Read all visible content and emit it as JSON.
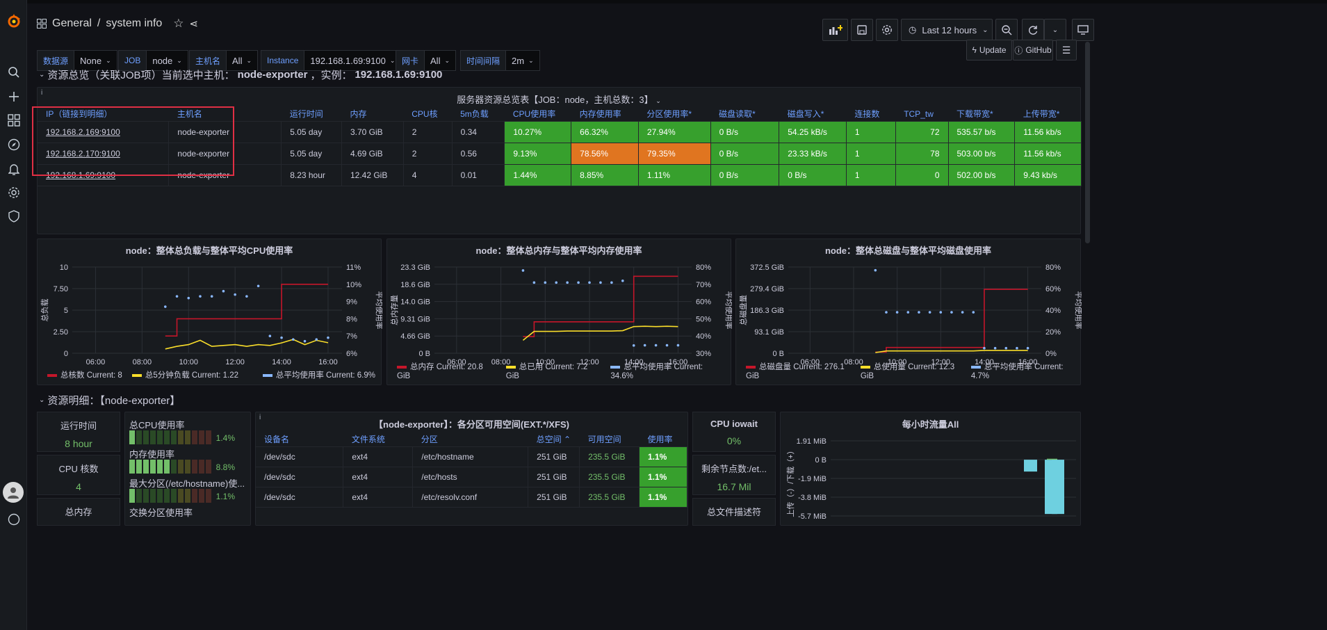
{
  "breadcrumb": {
    "folder": "General",
    "separator": "/",
    "title": "system info"
  },
  "time": {
    "range": "Last 12 hours"
  },
  "variables": [
    {
      "label": "数据源",
      "value": "None"
    },
    {
      "label": "JOB",
      "value": "node"
    },
    {
      "label": "主机名",
      "value": "All"
    },
    {
      "label": "Instance",
      "value": "192.168.1.69:9100"
    },
    {
      "label": "网卡",
      "value": "All"
    },
    {
      "label": "时间间隔",
      "value": "2m"
    }
  ],
  "links": {
    "update": "Update",
    "github": "GitHub"
  },
  "row1": {
    "title": "资源总览（关联JOB项）当前选中主机：",
    "host": "node-exporter",
    "sep": "，实例：",
    "instance": "192.168.1.69:9100"
  },
  "overview": {
    "title": "服务器资源总览表【JOB：node，主机总数：3】",
    "headers": [
      "IP（链接到明细）",
      "主机名",
      "运行时间",
      "内存",
      "CPU核",
      "5m负载",
      "CPU使用率",
      "内存使用率",
      "分区使用率*",
      "磁盘读取*",
      "磁盘写入*",
      "连接数",
      "TCP_tw",
      "下载带宽*",
      "上传带宽*"
    ],
    "rows": [
      [
        "192.168.2.169:9100",
        "node-exporter",
        "5.05 day",
        "3.70 GiB",
        "2",
        "0.34",
        "10.27%",
        "66.32%",
        "27.94%",
        "0 B/s",
        "54.25 kB/s",
        "1",
        "72",
        "535.57 b/s",
        "11.56 kb/s"
      ],
      [
        "192.168.2.170:9100",
        "node-exporter",
        "5.05 day",
        "4.69 GiB",
        "2",
        "0.56",
        "9.13%",
        "78.56%",
        "79.35%",
        "0 B/s",
        "23.33 kB/s",
        "1",
        "78",
        "503.00 b/s",
        "11.56 kb/s"
      ],
      [
        "192.168.1.69:9100",
        "node-exporter",
        "8.23 hour",
        "12.42 GiB",
        "4",
        "0.01",
        "1.44%",
        "8.85%",
        "1.11%",
        "0 B/s",
        "0 B/s",
        "1",
        "0",
        "502.00 b/s",
        "9.43 kb/s"
      ]
    ],
    "cell_colors": [
      [
        "",
        "",
        "",
        "",
        "",
        "",
        "green",
        "green",
        "green",
        "green",
        "green",
        "green",
        "green",
        "green",
        "green"
      ],
      [
        "",
        "",
        "",
        "",
        "",
        "",
        "green",
        "orange",
        "orange",
        "green",
        "green",
        "green",
        "green",
        "green",
        "green"
      ],
      [
        "",
        "",
        "",
        "",
        "",
        "",
        "green",
        "green",
        "green",
        "green",
        "green",
        "green",
        "green",
        "green",
        "green"
      ]
    ]
  },
  "colors": {
    "red": "#c4162a",
    "yellow": "#fade2a",
    "cyan": "#8ab8ff",
    "green": "#37a02d",
    "orange": "#e07520",
    "highlight": "#e02f44",
    "accent": "#6e9fff"
  },
  "chart_data": [
    {
      "type": "line",
      "title": "node：整体总负载与整体平均CPU使用率",
      "x": [
        "09:00",
        "09:30",
        "10:00",
        "10:30",
        "11:00",
        "11:30",
        "12:00",
        "12:30",
        "13:00",
        "13:30",
        "14:00",
        "14:30",
        "15:00",
        "15:30",
        "16:00"
      ],
      "xticks": [
        "06:00",
        "08:00",
        "10:00",
        "12:00",
        "14:00",
        "16:00"
      ],
      "ylabel": "总负载",
      "ylabel2": "平均使用率",
      "yticks": [
        "0",
        "2.50",
        "5",
        "7.50",
        "10"
      ],
      "yticks2": [
        "6%",
        "7%",
        "8%",
        "9%",
        "10%",
        "11%"
      ],
      "ylim": [
        0,
        10
      ],
      "ylim2": [
        6,
        11
      ],
      "series": [
        {
          "name": "总核数",
          "axis": "left",
          "color": "#c4162a",
          "values": [
            2,
            4,
            4,
            4,
            4,
            4,
            4,
            4,
            4,
            4,
            8,
            8,
            8,
            8,
            8
          ]
        },
        {
          "name": "总5分钟负载",
          "axis": "left",
          "color": "#fade2a",
          "values": [
            0.5,
            0.8,
            1.0,
            1.5,
            0.8,
            0.9,
            1.0,
            0.8,
            1.0,
            0.9,
            1.2,
            1.6,
            1.0,
            1.5,
            1.22
          ]
        },
        {
          "name": "总平均使用率",
          "axis": "right",
          "color": "#8ab8ff",
          "points": true,
          "values": [
            8.7,
            9.3,
            9.2,
            9.3,
            9.3,
            9.6,
            9.4,
            9.3,
            9.9,
            7,
            6.9,
            6.8,
            6.7,
            6.8,
            6.9
          ]
        }
      ],
      "legend": [
        {
          "name": "总核数",
          "current": "Current: 8"
        },
        {
          "name": "总5分钟负载",
          "current": "Current: 1.22"
        },
        {
          "name": "总平均使用率",
          "current": "Current: 6.9%"
        }
      ]
    },
    {
      "type": "line",
      "title": "node：整体总内存与整体平均内存使用率",
      "x": [
        "09:00",
        "09:30",
        "10:00",
        "10:30",
        "11:00",
        "11:30",
        "12:00",
        "12:30",
        "13:00",
        "13:30",
        "14:00",
        "14:30",
        "15:00",
        "15:30",
        "16:00"
      ],
      "xticks": [
        "06:00",
        "08:00",
        "10:00",
        "12:00",
        "14:00",
        "16:00"
      ],
      "ylabel": "总内存量",
      "ylabel2": "平均使用率",
      "yticks": [
        "0 B",
        "4.66 GiB",
        "9.31 GiB",
        "14.0 GiB",
        "18.6 GiB",
        "23.3 GiB"
      ],
      "yticks2": [
        "30%",
        "40%",
        "50%",
        "60%",
        "70%",
        "80%"
      ],
      "ylim": [
        0,
        23.3
      ],
      "ylim2": [
        30,
        80
      ],
      "series": [
        {
          "name": "总内存",
          "axis": "left",
          "color": "#c4162a",
          "values": [
            4.5,
            8.5,
            8.5,
            8.5,
            8.5,
            8.5,
            8.5,
            8.5,
            8.5,
            8.5,
            20.8,
            20.8,
            20.8,
            20.8,
            20.8
          ]
        },
        {
          "name": "总已用",
          "axis": "left",
          "color": "#fade2a",
          "values": [
            3.5,
            5.9,
            5.9,
            5.9,
            6.0,
            6.0,
            6.0,
            6.0,
            6.0,
            6.1,
            7.2,
            7.3,
            7.2,
            7.3,
            7.2
          ]
        },
        {
          "name": "总平均使用率",
          "axis": "right",
          "color": "#8ab8ff",
          "points": true,
          "values": [
            78,
            71,
            71,
            71,
            71,
            71,
            71,
            71,
            71,
            72,
            34.5,
            34.6,
            34.6,
            34.6,
            34.6
          ]
        }
      ],
      "legend": [
        {
          "name": "总内存",
          "current": "Current: 20.8 GiB"
        },
        {
          "name": "总已用",
          "current": "Current: 7.2 GiB"
        },
        {
          "name": "总平均使用率",
          "current": "Current: 34.6%"
        }
      ]
    },
    {
      "type": "line",
      "title": "node：整体总磁盘与整体平均磁盘使用率",
      "x": [
        "09:00",
        "09:30",
        "10:00",
        "10:30",
        "11:00",
        "11:30",
        "12:00",
        "12:30",
        "13:00",
        "13:30",
        "14:00",
        "14:30",
        "15:00",
        "15:30",
        "16:00"
      ],
      "xticks": [
        "06:00",
        "08:00",
        "10:00",
        "12:00",
        "14:00",
        "16:00"
      ],
      "ylabel": "总磁盘量",
      "ylabel2": "平均使用率",
      "yticks": [
        "0 B",
        "93.1 GiB",
        "186.3 GiB",
        "279.4 GiB",
        "372.5 GiB"
      ],
      "yticks2": [
        "0%",
        "20%",
        "40%",
        "60%",
        "80%"
      ],
      "ylim": [
        0,
        372.5
      ],
      "ylim2": [
        0,
        80
      ],
      "series": [
        {
          "name": "总磁盘量",
          "axis": "left",
          "color": "#c4162a",
          "values": [
            5,
            25,
            25,
            25,
            25,
            25,
            25,
            25,
            25,
            25,
            276.1,
            276.1,
            276.1,
            276.1,
            276.1
          ]
        },
        {
          "name": "总使用量",
          "axis": "left",
          "color": "#fade2a",
          "values": [
            3,
            10,
            10,
            10,
            10,
            10,
            10,
            10,
            10,
            10,
            12.3,
            12.3,
            12.3,
            12.3,
            12.3
          ]
        },
        {
          "name": "总平均使用率",
          "axis": "right",
          "color": "#8ab8ff",
          "points": true,
          "values": [
            77,
            38,
            38,
            38,
            38,
            38,
            38,
            38,
            38,
            38,
            4.7,
            4.7,
            4.7,
            4.7,
            4.7
          ]
        }
      ],
      "legend": [
        {
          "name": "总磁盘量",
          "current": "Current: 276.1 GiB"
        },
        {
          "name": "总使用量",
          "current": "Current: 12.3 GiB"
        },
        {
          "name": "总平均使用率",
          "current": "Current: 4.7%"
        }
      ]
    }
  ],
  "row2": {
    "title": "资源明细：【node-exporter】"
  },
  "stats": {
    "uptime": {
      "label": "运行时间",
      "value": "8 hour"
    },
    "cores": {
      "label": "CPU 核数",
      "value": "4"
    },
    "totalmem": {
      "label": "总内存"
    },
    "iowait": {
      "label": "CPU iowait",
      "value": "0%"
    },
    "nodes": {
      "label": "剩余节点数:/et...",
      "value": "16.7 Mil"
    },
    "fd": {
      "label": "总文件描述符"
    }
  },
  "bars": [
    {
      "label": "总CPU使用率",
      "value": "1.4%",
      "level": 0.014
    },
    {
      "label": "内存使用率",
      "value": "8.8%",
      "level": 0.088
    },
    {
      "label": "最大分区(/etc/hostname)使...",
      "value": "1.1%",
      "level": 0.011
    },
    {
      "label": "交换分区使用率"
    }
  ],
  "fs": {
    "title": "【node-exporter】：各分区可用空间(EXT.*/XFS)",
    "headers": [
      "设备名",
      "文件系统",
      "分区",
      "总空间",
      "可用空间",
      "使用率"
    ],
    "sort_indicator": "⌃",
    "rows": [
      [
        "/dev/sdc",
        "ext4",
        "/etc/hostname",
        "251 GiB",
        "235.5 GiB",
        "1.1%"
      ],
      [
        "/dev/sdc",
        "ext4",
        "/etc/hosts",
        "251 GiB",
        "235.5 GiB",
        "1.1%"
      ],
      [
        "/dev/sdc",
        "ext4",
        "/etc/resolv.conf",
        "251 GiB",
        "235.5 GiB",
        "1.1%"
      ]
    ]
  },
  "traffic": {
    "title": "每小时流量All",
    "ylabel": "上传（-）/下载（+）",
    "yticks": [
      "1.91 MiB",
      "0 B",
      "-1.9 MiB",
      "-3.8 MiB",
      "-5.7 MiB"
    ],
    "chart_data": {
      "type": "bar",
      "series": [
        {
          "values": [
            -1.2,
            -5.5,
            0.1,
            -5.5
          ]
        }
      ],
      "ylim": [
        -5.7,
        1.91
      ]
    }
  }
}
